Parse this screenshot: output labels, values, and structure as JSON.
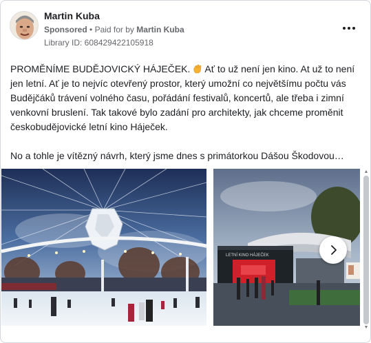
{
  "post": {
    "author": "Martin Kuba",
    "sponsored": "Sponsored",
    "separator": "•",
    "paid_for_by_prefix": "Paid for by",
    "paid_for_by_name": "Martin Kuba",
    "library_id": "Library ID: 608429422105918"
  },
  "body": {
    "paragraph1_part1": "PROMĚNÍME BUDĚJOVICKÝ HÁJEČEK.",
    "paragraph1_part2": " Ať to už není jen kino. At už to není jen letní. Ať je to nejvíc otevřený prostor, který umožní co největšímu počtu vás Budějčáků trávení volného času, pořádání festivalů, koncertů, ale třeba i zimní venkovní bruslení. Tak takové bylo zadání pro architekty, jak chceme proměnit českobudějovické letní kino Háječek.",
    "paragraph2": "No a tohle je vítězný návrh, který jsme dnes s primátorkou Dášou Škodovou…"
  },
  "media": {
    "slide2_sign": "LETNÍ KINO HÁJEČEK"
  },
  "icons": {
    "more": "more-horizontal-icon",
    "wave": "waving-hand-emoji",
    "next": "chevron-right-icon"
  },
  "colors": {
    "text_primary": "#1c1e21",
    "text_secondary": "#65676b",
    "border": "#d3d6db"
  }
}
